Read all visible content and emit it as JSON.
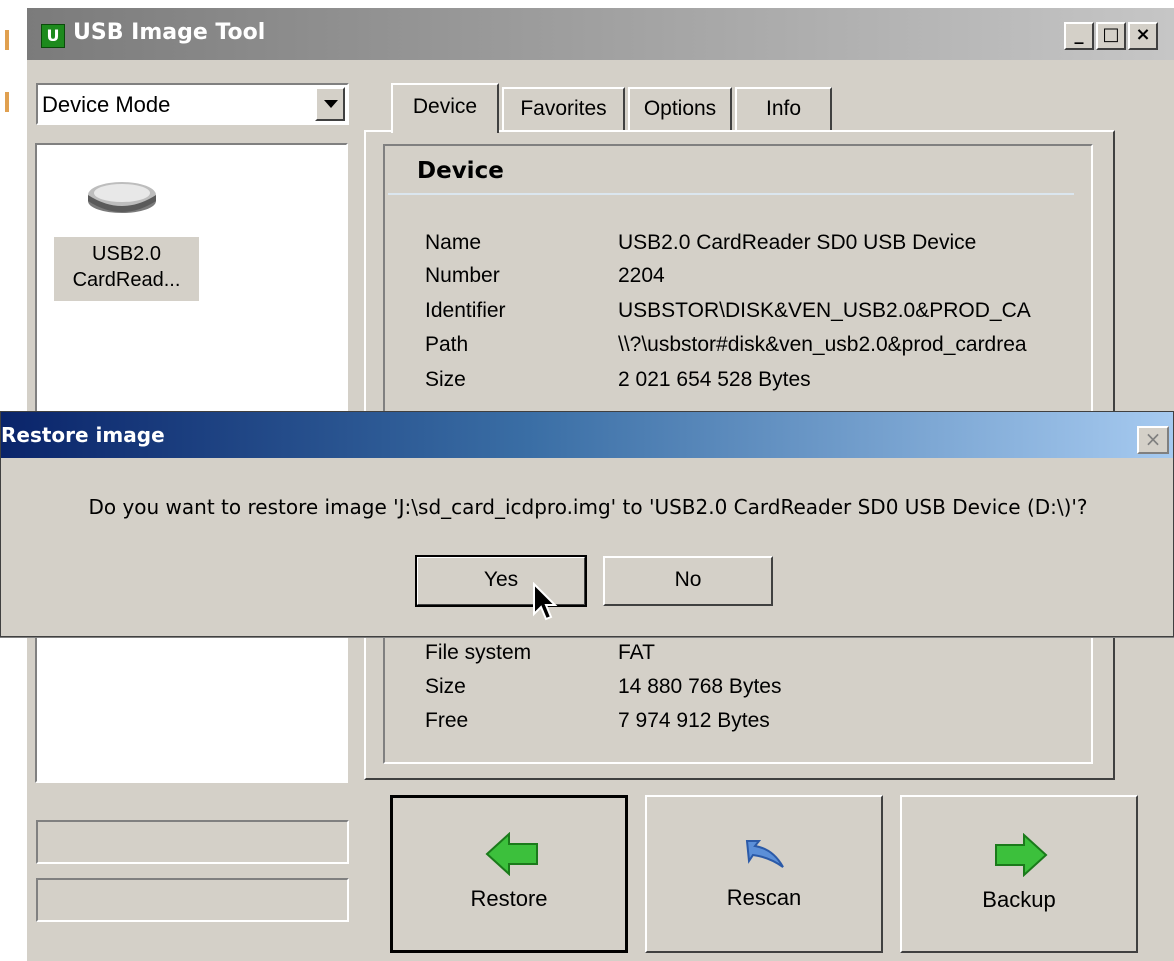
{
  "window": {
    "title": "USB Image Tool",
    "icon_letter": "U",
    "controls": {
      "minimize": "_",
      "maximize": "□",
      "close": "×"
    }
  },
  "mode_select": {
    "value": "Device Mode"
  },
  "device_list": [
    {
      "label": "USB2.0 CardRead...",
      "icon": "usb-drive-icon"
    }
  ],
  "tabs": [
    {
      "label": "Device",
      "active": true
    },
    {
      "label": "Favorites",
      "active": false
    },
    {
      "label": "Options",
      "active": false
    },
    {
      "label": "Info",
      "active": false
    }
  ],
  "device_section": {
    "title": "Device",
    "rows": [
      {
        "key": "Name",
        "value": "USB2.0 CardReader SD0 USB Device"
      },
      {
        "key": "Number",
        "value": "2204"
      },
      {
        "key": "Identifier",
        "value": "USBSTOR\\DISK&VEN_USB2.0&PROD_CA"
      },
      {
        "key": "Path",
        "value": "\\\\?\\usbstor#disk&ven_usb2.0&prod_cardrea"
      },
      {
        "key": "Size",
        "value": "2 021 654 528 Bytes"
      }
    ]
  },
  "volume_section": {
    "rows": [
      {
        "key": "File system",
        "value": "FAT"
      },
      {
        "key": "Size",
        "value": "14 880 768 Bytes"
      },
      {
        "key": "Free",
        "value": "7 974 912 Bytes"
      }
    ]
  },
  "actions": {
    "restore": "Restore",
    "rescan": "Rescan",
    "backup": "Backup"
  },
  "dialog": {
    "title": "Restore image",
    "message": "Do you want to restore image 'J:\\sd_card_icdpro.img' to 'USB2.0 CardReader SD0 USB Device (D:\\)'?",
    "yes": "Yes",
    "no": "No",
    "close": "×"
  },
  "colors": {
    "face": "#d4d0c8",
    "dialog_title_start": "#0a246a",
    "dialog_title_end": "#a6caf0",
    "arrow_green": "#3cc03c",
    "rescan_blue": "#5b8fd8"
  }
}
